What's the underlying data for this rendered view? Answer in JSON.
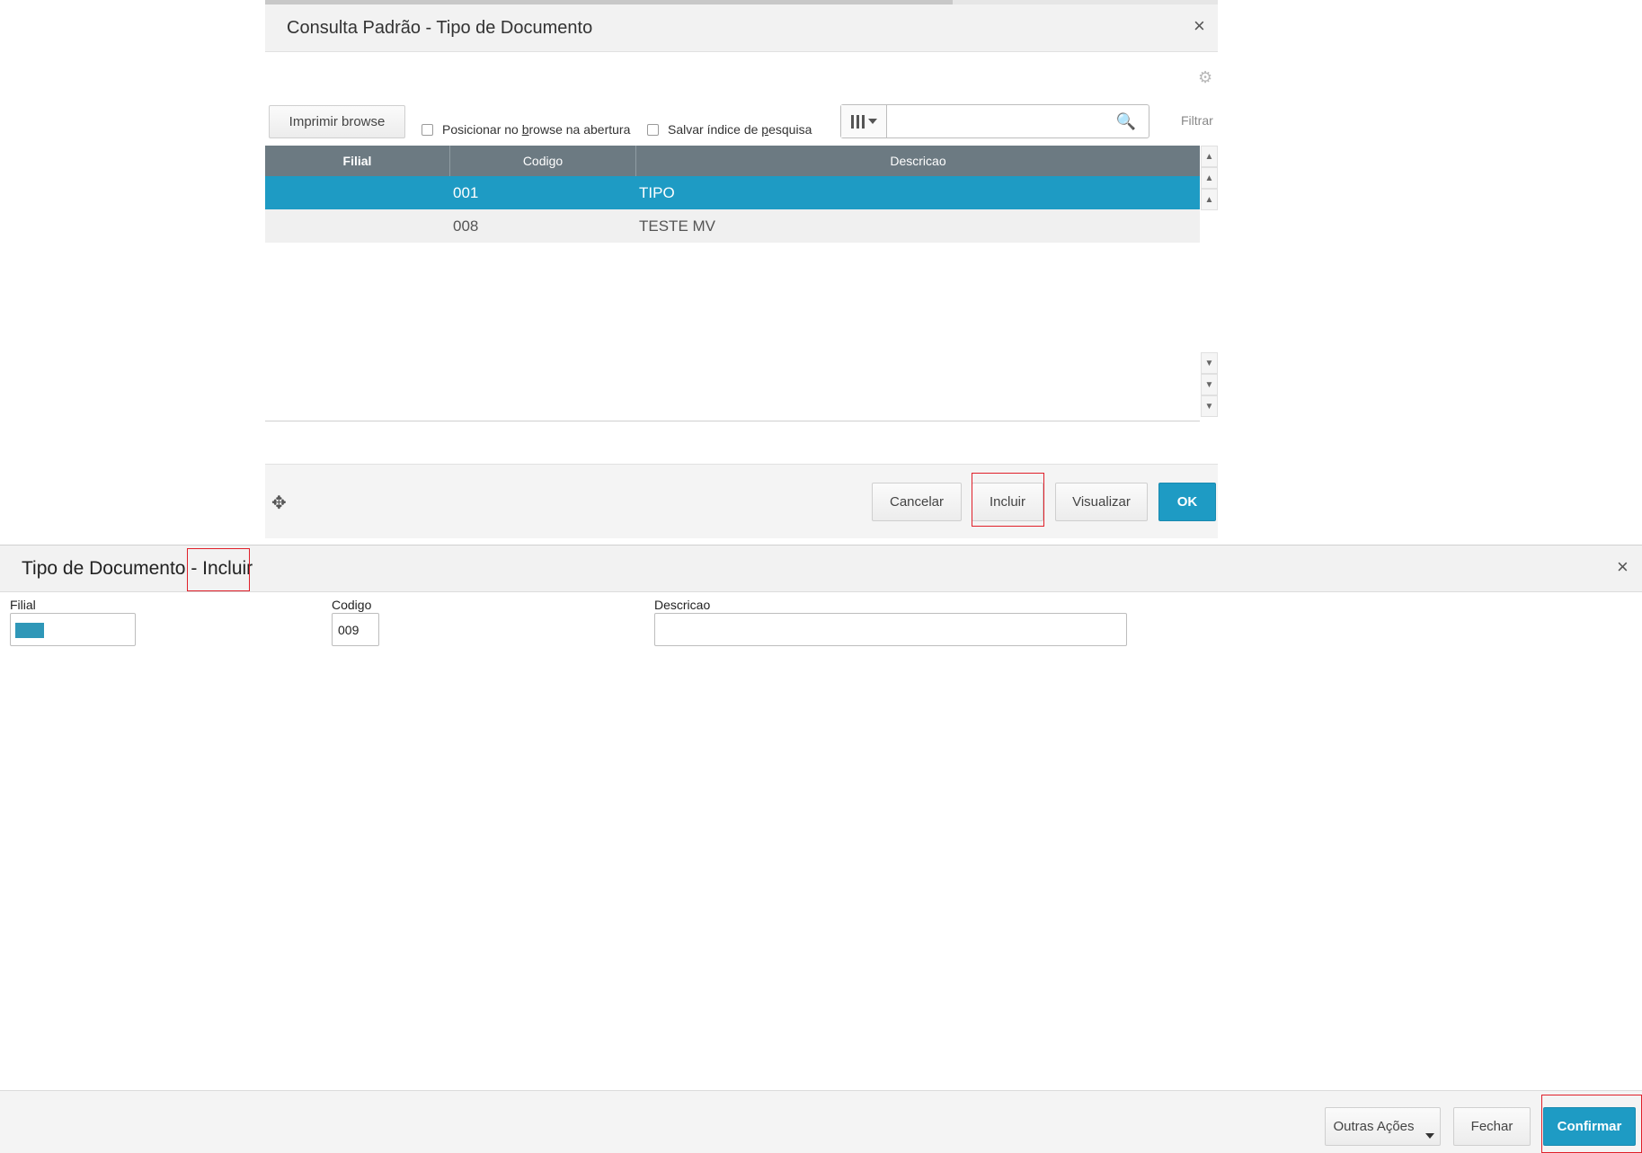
{
  "colors": {
    "accent": "#1e9bc4",
    "grid_header": "#6c7a82",
    "highlight_border": "#e0202a",
    "filial_swatch": "#2f97b8"
  },
  "consulta": {
    "title": "Consulta Padrão - Tipo de Documento",
    "close_icon": "×",
    "gear_icon": "⚙",
    "print_button": "Imprimir browse",
    "checkbox_posicionar": {
      "before": "Posicionar no ",
      "underlined": "b",
      "after": "rowse na abertura"
    },
    "checkbox_salvar": {
      "before": "Salvar índice de ",
      "underlined": "p",
      "after": "esquisa"
    },
    "search": {
      "value": "",
      "placeholder": ""
    },
    "search_icon": "🔍",
    "filter_label": "Filtrar",
    "columns": [
      "Filial",
      "Codigo",
      "Descricao"
    ],
    "rows": [
      {
        "filial": "",
        "codigo": "001",
        "descricao": "TIPO",
        "selected": true
      },
      {
        "filial": "",
        "codigo": "008",
        "descricao": "TESTE MV",
        "selected": false
      }
    ],
    "move_icon": "✥",
    "buttons": {
      "cancelar": "Cancelar",
      "incluir": "Incluir",
      "visualizar": "Visualizar",
      "ok": "OK"
    }
  },
  "incluir": {
    "title_prefix": "Tipo de Documento - ",
    "title_action": "Incluir",
    "close_icon": "×",
    "fields": {
      "filial": {
        "label": "Filial",
        "value": ""
      },
      "codigo": {
        "label": "Codigo",
        "value": "009"
      },
      "descricao": {
        "label": "Descricao",
        "value": ""
      }
    },
    "buttons": {
      "outras_acoes": "Outras Ações",
      "fechar": "Fechar",
      "confirmar": "Confirmar"
    }
  }
}
